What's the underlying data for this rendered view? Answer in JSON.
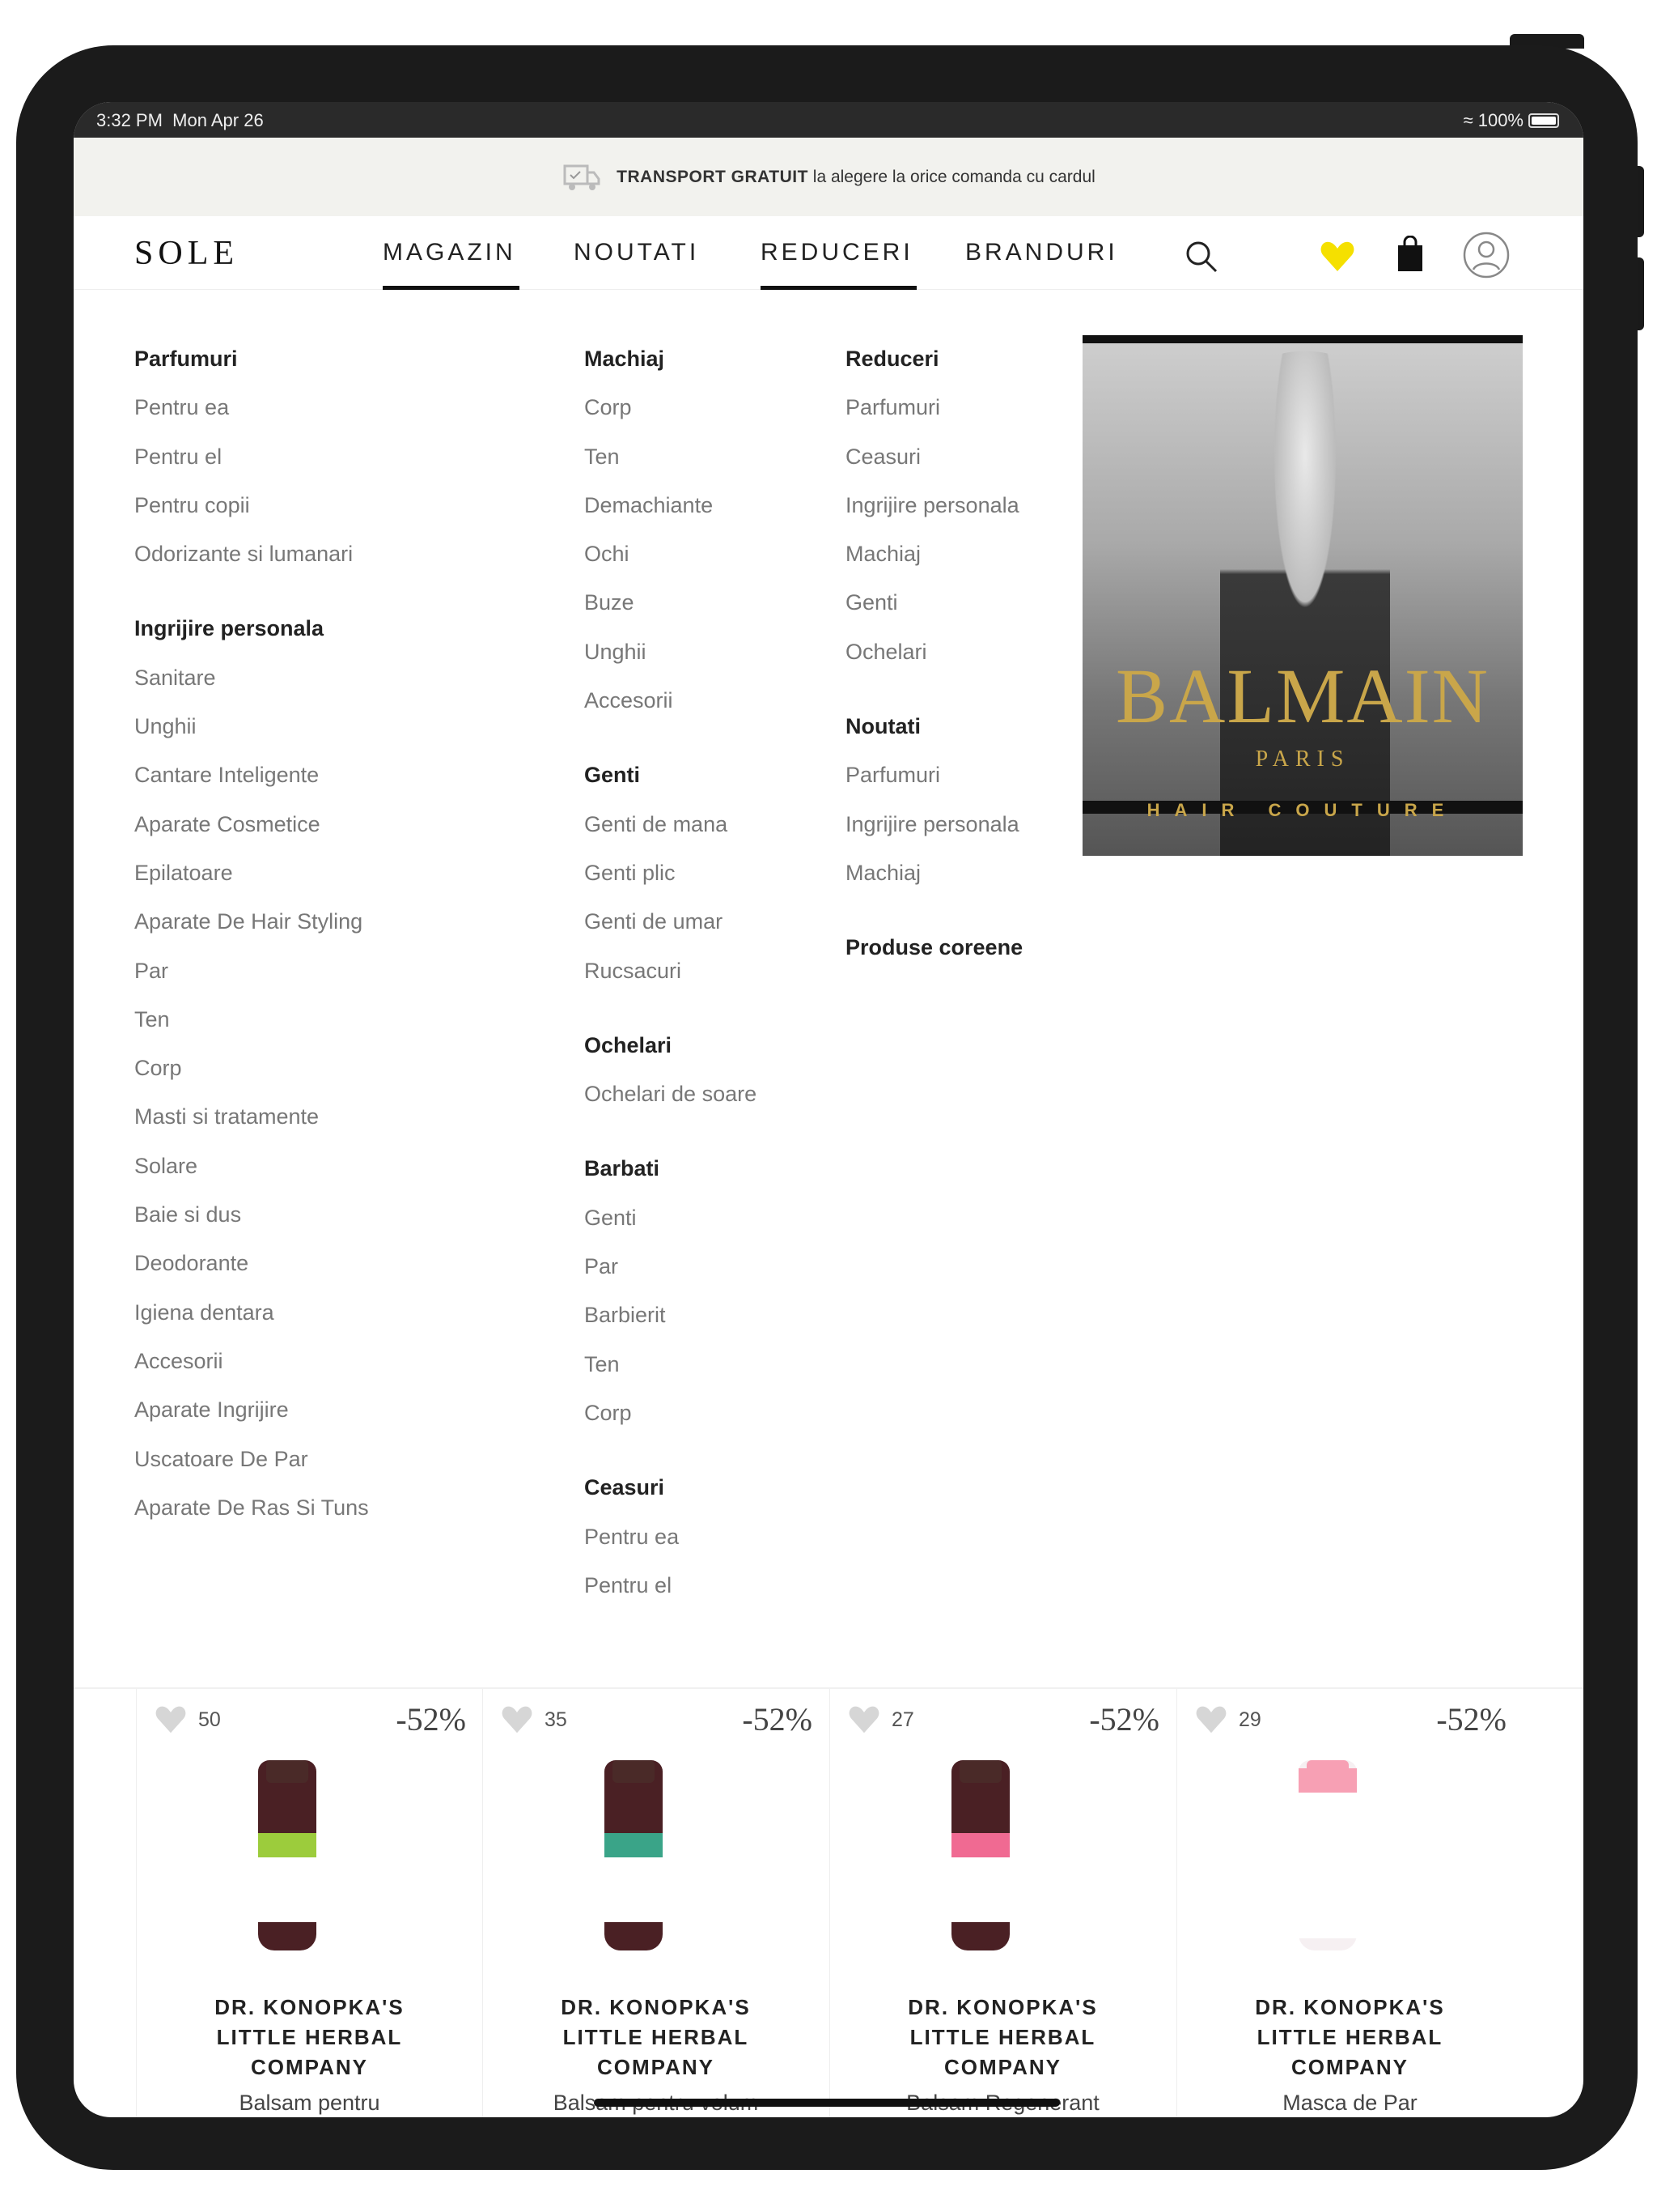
{
  "status_bar": {
    "time": "3:32 PM",
    "date": "Mon Apr 26",
    "battery": "100%"
  },
  "banner": {
    "bold": "TRANSPORT GRATUIT",
    "text": "la alegere la orice comanda cu cardul",
    "icon": "truck-icon"
  },
  "header": {
    "logo": "SOLE",
    "nav": [
      {
        "label": "MAGAZIN",
        "active": true
      },
      {
        "label": "NOUTATI",
        "active": false
      },
      {
        "label": "REDUCERI",
        "active": true
      },
      {
        "label": "BRANDURI",
        "active": false
      }
    ],
    "favorites_color": "#f5e000"
  },
  "menu": {
    "columns": [
      [
        {
          "title": "Parfumuri",
          "items": [
            "Pentru ea",
            "Pentru el",
            "Pentru copii",
            "Odorizante si lumanari"
          ]
        },
        {
          "title": "Ingrijire personala",
          "items": [
            "Sanitare",
            "Unghii",
            "Cantare Inteligente",
            "Aparate Cosmetice",
            "Epilatoare",
            "Aparate De Hair Styling",
            "Par",
            "Ten",
            "Corp",
            "Masti si tratamente",
            "Solare",
            "Baie si dus",
            "Deodorante",
            "Igiena dentara",
            "Accesorii",
            "Aparate Ingrijire",
            "Uscatoare De Par",
            "Aparate De Ras Si Tuns"
          ]
        }
      ],
      [
        {
          "title": "Machiaj",
          "items": [
            "Corp",
            "Ten",
            "Demachiante",
            "Ochi",
            "Buze",
            "Unghii",
            "Accesorii"
          ]
        },
        {
          "title": "Genti",
          "items": [
            "Genti de mana",
            "Genti plic",
            "Genti de umar",
            "Rucsacuri"
          ]
        },
        {
          "title": "Ochelari",
          "items": [
            "Ochelari de soare"
          ]
        },
        {
          "title": "Barbati",
          "items": [
            "Genti",
            "Par",
            "Barbierit",
            "Ten",
            "Corp"
          ]
        },
        {
          "title": "Ceasuri",
          "items": [
            "Pentru ea",
            "Pentru el"
          ]
        }
      ],
      [
        {
          "title": "Reduceri",
          "items": [
            "Parfumuri",
            "Ceasuri",
            "Ingrijire personala",
            "Machiaj",
            "Genti",
            "Ochelari"
          ]
        },
        {
          "title": "Noutati",
          "items": [
            "Parfumuri",
            "Ingrijire personala",
            "Machiaj"
          ]
        },
        {
          "title": "Produse coreene",
          "items": []
        }
      ]
    ]
  },
  "promo": {
    "brand": "BALMAIN",
    "city": "PARIS",
    "line": "HAIR COUTURE"
  },
  "products": [
    {
      "likes": "50",
      "discount": "-52%",
      "brand": [
        "DR. KONOPKA'S",
        "LITTLE HERBAL",
        "COMPANY"
      ],
      "name": "Balsam pentru",
      "color": "#9ccc3c"
    },
    {
      "likes": "35",
      "discount": "-52%",
      "brand": [
        "DR. KONOPKA'S",
        "LITTLE HERBAL",
        "COMPANY"
      ],
      "name": "Balsam pentru volum",
      "color": "#3aa488"
    },
    {
      "likes": "27",
      "discount": "-52%",
      "brand": [
        "DR. KONOPKA'S",
        "LITTLE HERBAL",
        "COMPANY"
      ],
      "name": "Balsam Regenerant",
      "color": "#f06a92"
    },
    {
      "likes": "29",
      "discount": "-52%",
      "brand": [
        "DR. KONOPKA'S",
        "LITTLE HERBAL",
        "COMPANY"
      ],
      "name": "Masca de Par",
      "color": "#f7a0b4"
    }
  ]
}
